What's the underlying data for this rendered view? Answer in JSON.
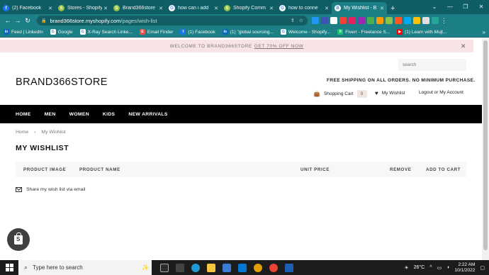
{
  "browser": {
    "tabs": [
      {
        "label": "(2) Facebook",
        "icon": "facebook-icon",
        "color": "#1877f2",
        "glyph": "f",
        "active": false
      },
      {
        "label": "Stores - Shopify",
        "icon": "shopify-icon",
        "color": "#95bf47",
        "glyph": "S",
        "active": false
      },
      {
        "label": "Brand366store",
        "icon": "shopify-icon",
        "color": "#95bf47",
        "glyph": "S",
        "active": false
      },
      {
        "label": "how can i add",
        "icon": "google-icon",
        "color": "#ffffff",
        "glyph": "G",
        "active": false
      },
      {
        "label": "Shopify Comm",
        "icon": "shopify-icon",
        "color": "#95bf47",
        "glyph": "S",
        "active": false
      },
      {
        "label": "how to conne",
        "icon": "google-icon",
        "color": "#ffffff",
        "glyph": "G",
        "active": false
      },
      {
        "label": "My Wishlist - B",
        "icon": "store-icon",
        "color": "#ffffff",
        "glyph": "B",
        "active": true
      }
    ],
    "address": {
      "host": "brand366store.myshopify.com",
      "path": "/pages/wish-list"
    },
    "bookmarks": [
      {
        "label": "Feed | LinkedIn",
        "color": "#0a66c2",
        "glyph": "in"
      },
      {
        "label": "Google",
        "color": "#ffffff",
        "glyph": "G"
      },
      {
        "label": "X-Ray Search Linke...",
        "color": "#ffffff",
        "glyph": "G"
      },
      {
        "label": "Email Finder",
        "color": "#e8534a",
        "glyph": "E"
      },
      {
        "label": "(1) Facebook",
        "color": "#1877f2",
        "glyph": "f"
      },
      {
        "label": "(1) \"global sourcing...",
        "color": "#0a66c2",
        "glyph": "in"
      },
      {
        "label": "Welcome - Shopify...",
        "color": "#ffffff",
        "glyph": "G"
      },
      {
        "label": "Fiverr - Freelance S...",
        "color": "#1dbf73",
        "glyph": "fi"
      },
      {
        "label": "(1) Learn with Mujt...",
        "color": "#ff0000",
        "glyph": "▶"
      }
    ]
  },
  "store": {
    "announcement": "WELCOME TO BRAND366STORE",
    "announcement_link": "GET 70% OFF NOW",
    "search_placeholder": "search",
    "logo": "BRAND366STORE",
    "shipping": "FREE SHIPPING ON ALL ORDERS. NO MINIMUM PURCHASE.",
    "cart_label": "Shopping Cart",
    "cart_count": "0",
    "wishlist_label": "My Wishlist",
    "account_label": "Logout or My Account",
    "nav": [
      "HOME",
      "MEN",
      "WOMEN",
      "KIDS",
      "NEW ARRIVALS"
    ],
    "breadcrumb": {
      "home": "Home",
      "sep": "›",
      "current": "My Wishlist"
    },
    "page_title": "MY WISHLIST",
    "columns": {
      "image": "PRODUCT IMAGE",
      "name": "PRODUCT NAME",
      "price": "UNIT PRICE",
      "remove": "REMOVE",
      "cart": "ADD TO CART"
    },
    "share": "Share my wish list via email"
  },
  "taskbar": {
    "search_placeholder": "Type here to search",
    "weather": "26°C",
    "time": "2:22 AM",
    "date": "10/1/2022"
  }
}
